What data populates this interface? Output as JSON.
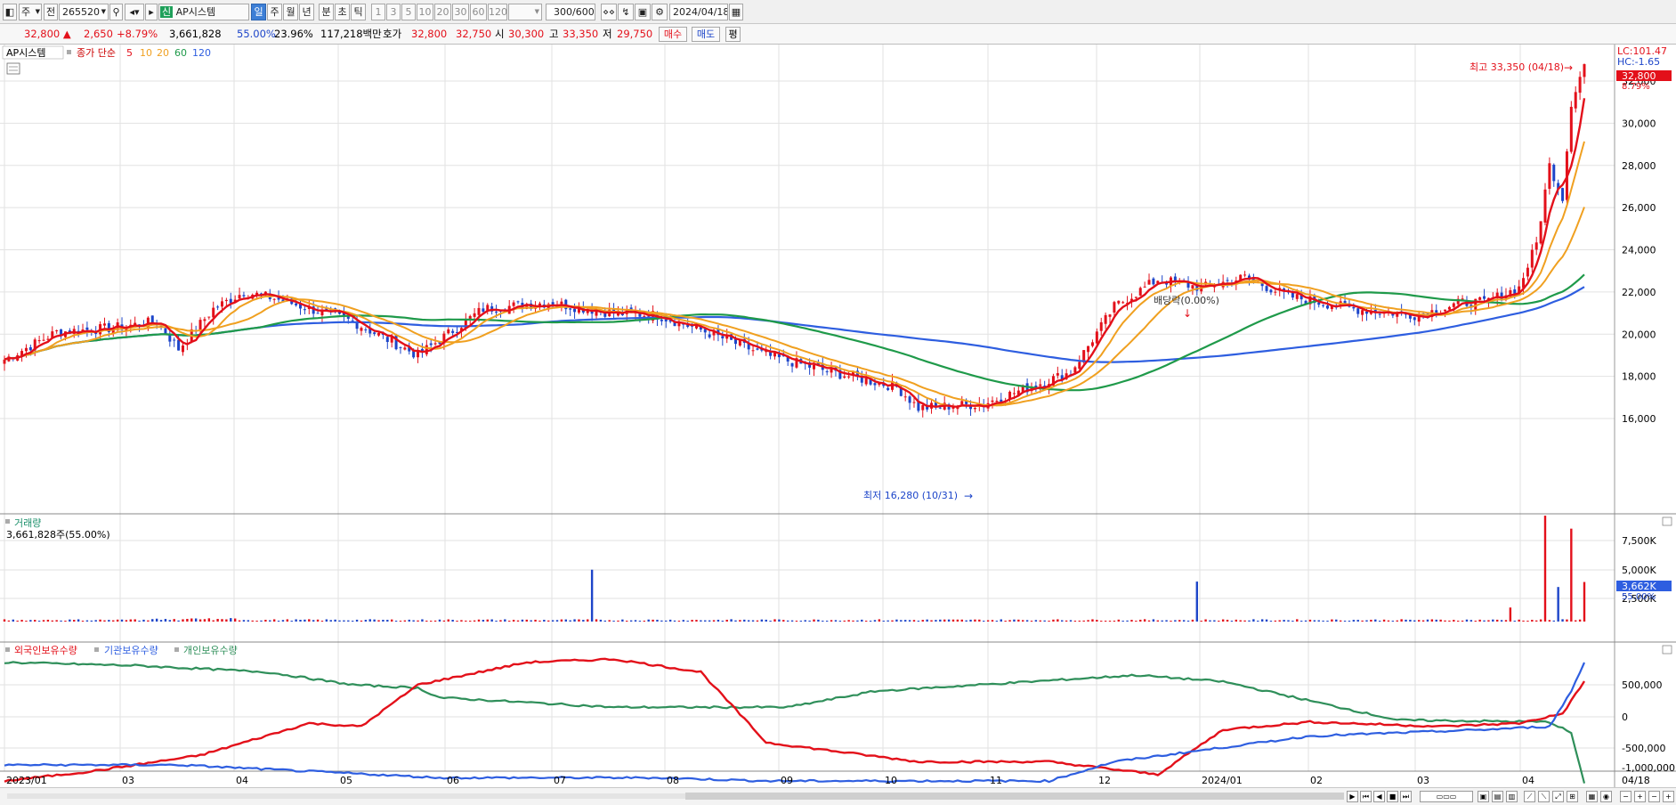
{
  "toolbar": {
    "period_select": "주",
    "market_select": "전",
    "code_input": "265520",
    "stock_name": "AP시스템",
    "stock_badge": "신",
    "periods": [
      "일",
      "주",
      "월",
      "년",
      "분",
      "초",
      "틱"
    ],
    "active_period": "일",
    "minute_options": [
      "1",
      "3",
      "5",
      "10",
      "20",
      "30",
      "60",
      "120"
    ],
    "count_input": "300",
    "count_total": "/600",
    "date_input": "2024/04/18"
  },
  "quote": {
    "price": "32,800",
    "change_arrow": "▲",
    "change": "2,650",
    "change_pct": "+8.79%",
    "volume": "3,661,828",
    "volume_ratio": "55.00%",
    "turnover": "23.96%",
    "amount": "117,218백만",
    "hoga_label": "호가",
    "bid": "32,800",
    "ask": "32,750",
    "open_label": "시",
    "open": "30,300",
    "high_label": "고",
    "high": "33,350",
    "low_label": "저",
    "low": "29,750",
    "buy_label": "매수",
    "sell_label": "매도",
    "eval_label": "평"
  },
  "price_panel": {
    "name": "AP시스템",
    "ma_label": "종가 단순",
    "ma_periods": [
      "5",
      "10",
      "20",
      "60",
      "120"
    ],
    "ma_colors": [
      "#e3101a",
      "#f0a020",
      "#f0a020",
      "#1f9a4a",
      "#2e5ee0"
    ],
    "lc": "LC:101.47",
    "hc": "HC:-1.65",
    "current_price": "32,800",
    "current_pct": "8.79%",
    "max_note": "최고 33,350 (04/18)",
    "min_note": "최저 16,280 (10/31)",
    "dividend_note": "배당락(0.00%)",
    "y_ticks": [
      "32,000",
      "30,000",
      "28,000",
      "26,000",
      "24,000",
      "22,000",
      "20,000",
      "18,000",
      "16,000"
    ]
  },
  "volume_panel": {
    "title": "거래량",
    "info": "3,661,828주(55.00%)",
    "current": "3,662K",
    "current_pct": "55.00%",
    "y_ticks": [
      "7,500K",
      "5,000K",
      "2,500K"
    ]
  },
  "holdings_panel": {
    "series": [
      {
        "name": "외국인보유수량",
        "color": "#e3101a"
      },
      {
        "name": "기관보유수량",
        "color": "#2e5ee0"
      },
      {
        "name": "개인보유수량",
        "color": "#2f8f5a"
      }
    ],
    "y_ticks": [
      "500,000",
      "0",
      "-500,000",
      "-1,000,000"
    ]
  },
  "x_axis": {
    "labels": [
      "2023/01",
      "03",
      "04",
      "05",
      "06",
      "07",
      "08",
      "09",
      "10",
      "11",
      "12",
      "2024/01",
      "02",
      "03",
      "04"
    ],
    "last_label": "04/18"
  },
  "colors": {
    "up": "#e3101a",
    "down": "#1d45c9",
    "grid": "#e2e2e2"
  }
}
